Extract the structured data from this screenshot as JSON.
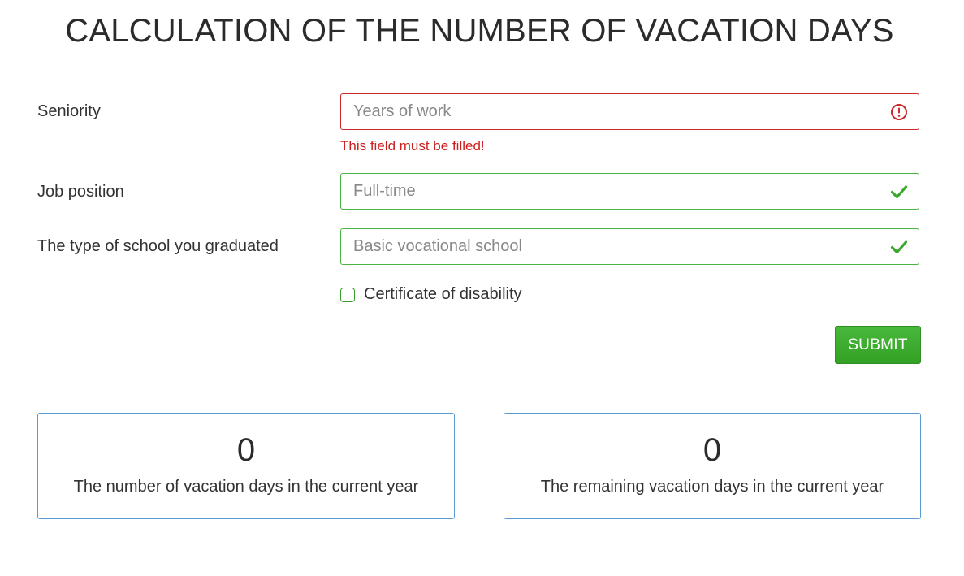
{
  "page": {
    "title": "CALCULATION OF THE NUMBER OF VACATION DAYS"
  },
  "form": {
    "seniority": {
      "label": "Seniority",
      "placeholder": "Years of work",
      "value": "",
      "status": "error",
      "status_icon": "error-circle-icon",
      "error_message": "This field must be filled!"
    },
    "job_position": {
      "label": "Job position",
      "placeholder": "Full-time",
      "value": "",
      "status": "valid",
      "status_icon": "check-icon"
    },
    "school_type": {
      "label": "The type of school you graduated",
      "placeholder": "Basic vocational school",
      "value": "",
      "status": "valid",
      "status_icon": "check-icon"
    },
    "disability": {
      "label": "Certificate of disability",
      "checked": false
    },
    "submit_label": "SUBMIT"
  },
  "results": {
    "total_days": {
      "value": "0",
      "caption": "The number of vacation days in the current year"
    },
    "remaining_days": {
      "value": "0",
      "caption": "The remaining vacation days in the current year"
    }
  },
  "colors": {
    "error": "#cc2a2a",
    "valid": "#4bb543",
    "submit": "#3aa82d",
    "card_border": "#5b9bd5"
  }
}
